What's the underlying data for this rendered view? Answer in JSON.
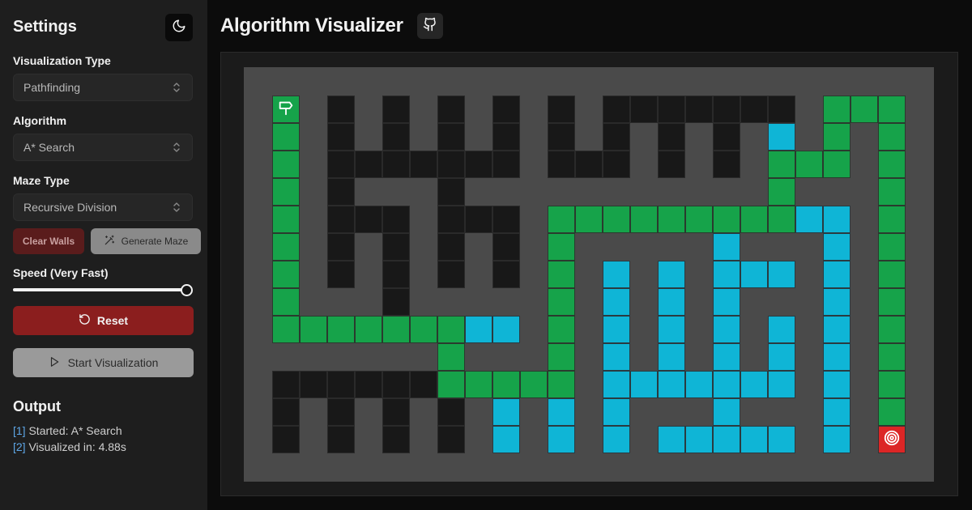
{
  "sidebar": {
    "title": "Settings",
    "visualization_type": {
      "label": "Visualization Type",
      "value": "Pathfinding"
    },
    "algorithm": {
      "label": "Algorithm",
      "value": "A* Search"
    },
    "maze_type": {
      "label": "Maze Type",
      "value": "Recursive Division"
    },
    "clear_walls_label": "Clear Walls",
    "generate_maze_label": "Generate Maze",
    "speed_label": "Speed (Very Fast)",
    "speed_fraction": 1.0,
    "reset_label": "Reset",
    "start_label": "Start Visualization",
    "output_title": "Output",
    "logs": [
      {
        "index": "[1]",
        "text": "Started: A* Search"
      },
      {
        "index": "[2]",
        "text": "Visualized in: 4.88s"
      }
    ]
  },
  "header": {
    "title": "Algorithm Visualizer"
  },
  "icons": {
    "theme": "moon-icon",
    "github": "github-icon",
    "generate": "magic-wand-icon",
    "reset": "rotate-ccw-icon",
    "start": "play-icon",
    "start_node": "signpost-icon",
    "target_node": "target-icon"
  },
  "colors": {
    "wall": "#181818",
    "empty": "#4a4a4a",
    "visited": "#0fb5d6",
    "path": "#16a34a",
    "start": "#16a34a",
    "target": "#dc2626",
    "reset_button": "#8b1e1e",
    "clear_walls_button": "#5a1c1c"
  },
  "grid": {
    "rows": 15,
    "cols": 25,
    "start": [
      1,
      1
    ],
    "target": [
      13,
      23
    ],
    "walls": [
      [
        1,
        3
      ],
      [
        1,
        5
      ],
      [
        1,
        7
      ],
      [
        1,
        9
      ],
      [
        1,
        11
      ],
      [
        1,
        13
      ],
      [
        1,
        14
      ],
      [
        1,
        15
      ],
      [
        1,
        16
      ],
      [
        1,
        17
      ],
      [
        1,
        18
      ],
      [
        1,
        19
      ],
      [
        2,
        3
      ],
      [
        2,
        5
      ],
      [
        2,
        7
      ],
      [
        2,
        9
      ],
      [
        2,
        11
      ],
      [
        2,
        13
      ],
      [
        2,
        15
      ],
      [
        2,
        17
      ],
      [
        3,
        3
      ],
      [
        3,
        4
      ],
      [
        3,
        5
      ],
      [
        3,
        6
      ],
      [
        3,
        7
      ],
      [
        3,
        8
      ],
      [
        3,
        9
      ],
      [
        3,
        11
      ],
      [
        3,
        12
      ],
      [
        3,
        13
      ],
      [
        3,
        15
      ],
      [
        3,
        17
      ],
      [
        4,
        3
      ],
      [
        4,
        7
      ],
      [
        5,
        3
      ],
      [
        5,
        4
      ],
      [
        5,
        5
      ],
      [
        5,
        7
      ],
      [
        5,
        8
      ],
      [
        5,
        9
      ],
      [
        6,
        3
      ],
      [
        6,
        5
      ],
      [
        6,
        7
      ],
      [
        6,
        9
      ],
      [
        7,
        3
      ],
      [
        7,
        5
      ],
      [
        7,
        7
      ],
      [
        7,
        9
      ],
      [
        8,
        5
      ],
      [
        11,
        1
      ],
      [
        11,
        2
      ],
      [
        11,
        3
      ],
      [
        11,
        4
      ],
      [
        11,
        5
      ],
      [
        11,
        6
      ],
      [
        12,
        1
      ],
      [
        12,
        3
      ],
      [
        12,
        5
      ],
      [
        12,
        7
      ],
      [
        13,
        1
      ],
      [
        13,
        3
      ],
      [
        13,
        5
      ],
      [
        13,
        7
      ]
    ],
    "visited": [
      [
        2,
        19
      ],
      [
        5,
        20
      ],
      [
        5,
        21
      ],
      [
        6,
        17
      ],
      [
        6,
        21
      ],
      [
        7,
        13
      ],
      [
        7,
        15
      ],
      [
        7,
        17
      ],
      [
        7,
        18
      ],
      [
        7,
        19
      ],
      [
        7,
        21
      ],
      [
        8,
        13
      ],
      [
        8,
        15
      ],
      [
        8,
        17
      ],
      [
        8,
        21
      ],
      [
        9,
        8
      ],
      [
        9,
        9
      ],
      [
        9,
        13
      ],
      [
        9,
        15
      ],
      [
        9,
        17
      ],
      [
        9,
        19
      ],
      [
        9,
        21
      ],
      [
        10,
        13
      ],
      [
        10,
        15
      ],
      [
        10,
        17
      ],
      [
        10,
        19
      ],
      [
        10,
        21
      ],
      [
        11,
        13
      ],
      [
        11,
        14
      ],
      [
        11,
        15
      ],
      [
        11,
        16
      ],
      [
        11,
        17
      ],
      [
        11,
        18
      ],
      [
        11,
        19
      ],
      [
        11,
        21
      ],
      [
        12,
        9
      ],
      [
        12,
        11
      ],
      [
        12,
        13
      ],
      [
        12,
        17
      ],
      [
        12,
        21
      ],
      [
        13,
        9
      ],
      [
        13,
        11
      ],
      [
        13,
        13
      ],
      [
        13,
        15
      ],
      [
        13,
        16
      ],
      [
        13,
        17
      ],
      [
        13,
        18
      ],
      [
        13,
        19
      ],
      [
        13,
        21
      ]
    ],
    "path": [
      [
        2,
        1
      ],
      [
        3,
        1
      ],
      [
        4,
        1
      ],
      [
        5,
        1
      ],
      [
        6,
        1
      ],
      [
        7,
        1
      ],
      [
        8,
        1
      ],
      [
        9,
        1
      ],
      [
        9,
        2
      ],
      [
        9,
        3
      ],
      [
        9,
        4
      ],
      [
        9,
        5
      ],
      [
        9,
        6
      ],
      [
        9,
        7
      ],
      [
        10,
        7
      ],
      [
        11,
        7
      ],
      [
        11,
        8
      ],
      [
        11,
        9
      ],
      [
        11,
        10
      ],
      [
        11,
        11
      ],
      [
        10,
        11
      ],
      [
        9,
        11
      ],
      [
        8,
        11
      ],
      [
        7,
        11
      ],
      [
        6,
        11
      ],
      [
        5,
        11
      ],
      [
        5,
        12
      ],
      [
        5,
        13
      ],
      [
        5,
        14
      ],
      [
        5,
        15
      ],
      [
        5,
        16
      ],
      [
        5,
        17
      ],
      [
        5,
        18
      ],
      [
        5,
        19
      ],
      [
        4,
        19
      ],
      [
        3,
        19
      ],
      [
        3,
        20
      ],
      [
        3,
        21
      ],
      [
        2,
        21
      ],
      [
        1,
        21
      ],
      [
        1,
        22
      ],
      [
        1,
        23
      ],
      [
        2,
        23
      ],
      [
        3,
        23
      ],
      [
        4,
        23
      ],
      [
        5,
        23
      ],
      [
        6,
        23
      ],
      [
        7,
        23
      ],
      [
        8,
        23
      ],
      [
        9,
        23
      ],
      [
        10,
        23
      ],
      [
        11,
        23
      ],
      [
        12,
        23
      ]
    ]
  }
}
